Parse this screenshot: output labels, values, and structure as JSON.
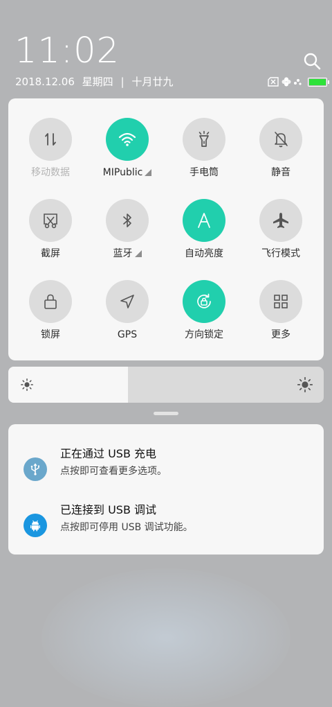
{
  "status_bar": {
    "time": "11:02",
    "date": "2018.12.06",
    "weekday": "星期四",
    "separator": "|",
    "lunar_date": "十月廿九",
    "battery_level": 1.0,
    "battery_color": "#2ee23a",
    "icons": [
      "no-sim-icon",
      "pinwheel-icon",
      "dots-icon",
      "battery-icon"
    ]
  },
  "quick_settings": {
    "accent_color": "#21cfad",
    "tiles": [
      {
        "label": "移动数据",
        "icon": "mobile-data-icon",
        "active": false,
        "disabled": true
      },
      {
        "label": "MIPublic",
        "icon": "wifi-icon",
        "active": true,
        "expandable": true
      },
      {
        "label": "手电筒",
        "icon": "flashlight-icon",
        "active": false
      },
      {
        "label": "静音",
        "icon": "mute-bell-icon",
        "active": false
      },
      {
        "label": "截屏",
        "icon": "screenshot-icon",
        "active": false
      },
      {
        "label": "蓝牙",
        "icon": "bluetooth-icon",
        "active": false,
        "expandable": true
      },
      {
        "label": "自动亮度",
        "icon": "auto-brightness-icon",
        "active": true
      },
      {
        "label": "飞行模式",
        "icon": "airplane-icon",
        "active": false
      },
      {
        "label": "锁屏",
        "icon": "lock-icon",
        "active": false
      },
      {
        "label": "GPS",
        "icon": "gps-icon",
        "active": false
      },
      {
        "label": "方向锁定",
        "icon": "rotation-lock-icon",
        "active": true
      },
      {
        "label": "更多",
        "icon": "grid-icon",
        "active": false
      }
    ]
  },
  "brightness": {
    "level": 0.38,
    "low_icon": "sun-small-icon",
    "high_icon": "sun-large-icon"
  },
  "notifications": [
    {
      "title": "正在通过 USB 充电",
      "text": "点按即可查看更多选项。",
      "icon": "usb-icon",
      "icon_color": "#6aa7cb"
    },
    {
      "title": "已连接到 USB 调试",
      "text": "点按即可停用 USB 调试功能。",
      "icon": "android-icon",
      "icon_color": "#1a96e0"
    }
  ]
}
